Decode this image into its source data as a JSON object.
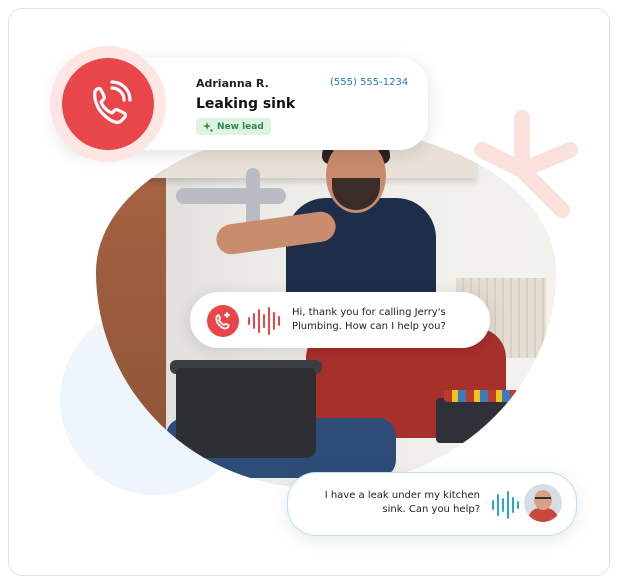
{
  "lead": {
    "name": "Adrianna R.",
    "phone": "(555) 555-1234",
    "title": "Leaking sink",
    "tag": "New lead"
  },
  "conversation": {
    "assistant_message": "Hi, thank you for calling Jerry's Plumbing. How can I help you?",
    "caller_message": "I have a leak under my kitchen sink. Can you help?"
  },
  "icons": {
    "call": "phone-ringing-icon",
    "tag": "sparkle-icon",
    "assistant": "ai-phone-icon",
    "assistant_wave": "audio-wave-icon",
    "caller_wave": "audio-wave-icon",
    "avatar": "caller-avatar"
  },
  "colors": {
    "accent_red": "#e9464a",
    "accent_blue": "#2aa7c4",
    "tag_green": "#2c8a49",
    "phone_blue": "#2b77b9"
  }
}
